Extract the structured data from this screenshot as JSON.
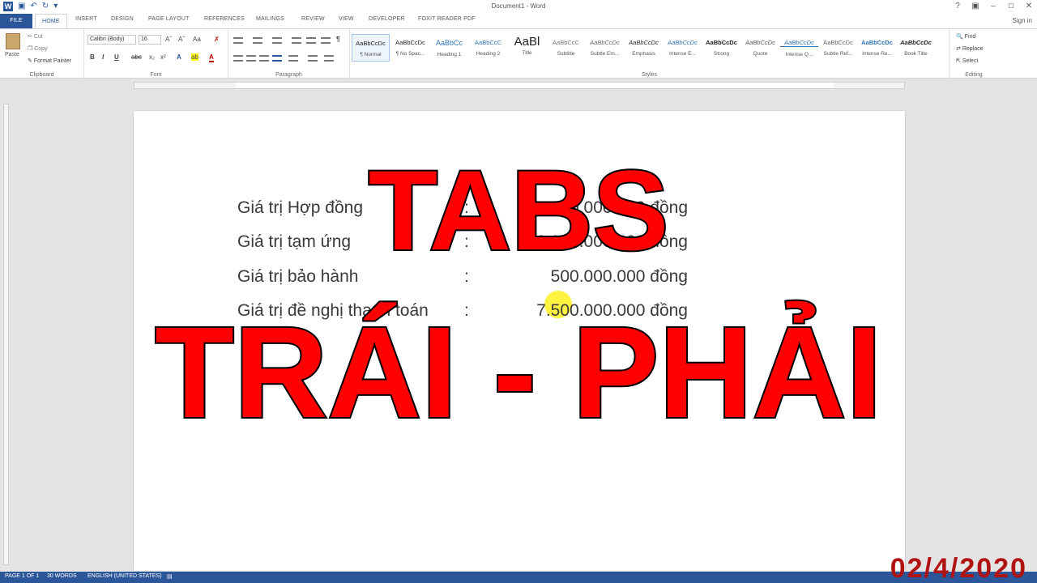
{
  "window": {
    "title": "Document1 - Word",
    "help": "?",
    "sign_in": "Sign in"
  },
  "quick_access": {
    "app_icon": "word-logo-icon",
    "save_icon": "save-icon",
    "undo_icon": "undo-icon",
    "redo_icon": "redo-icon",
    "customize_icon": "chevron-down-icon"
  },
  "tabs": [
    {
      "label": "FILE"
    },
    {
      "label": "HOME"
    },
    {
      "label": "INSERT"
    },
    {
      "label": "DESIGN"
    },
    {
      "label": "PAGE LAYOUT"
    },
    {
      "label": "REFERENCES"
    },
    {
      "label": "MAILINGS"
    },
    {
      "label": "REVIEW"
    },
    {
      "label": "VIEW"
    },
    {
      "label": "DEVELOPER"
    },
    {
      "label": "FOXIT READER PDF"
    }
  ],
  "ribbon": {
    "clipboard": {
      "label": "Clipboard",
      "paste": "Paste",
      "cut": "Cut",
      "copy": "Copy",
      "format_painter": "Format Painter"
    },
    "font": {
      "label": "Font",
      "font_name": "Calibri (Body)",
      "font_size": "16",
      "bold": "B",
      "italic": "I",
      "underline": "U"
    },
    "paragraph": {
      "label": "Paragraph"
    },
    "styles": {
      "label": "Styles",
      "items": [
        {
          "sample": "AaBbCcDc",
          "name": "¶ Normal"
        },
        {
          "sample": "AaBbCcDc",
          "name": "¶ No Spac..."
        },
        {
          "sample": "AaBbCc",
          "name": "Heading 1"
        },
        {
          "sample": "AaBbCcC",
          "name": "Heading 2"
        },
        {
          "sample": "AaBl",
          "name": "Title"
        },
        {
          "sample": "AaBbCcC",
          "name": "Subtitle"
        },
        {
          "sample": "AaBbCcDc",
          "name": "Subtle Em..."
        },
        {
          "sample": "AaBbCcDc",
          "name": "Emphasis"
        },
        {
          "sample": "AaBbCcDc",
          "name": "Intense E..."
        },
        {
          "sample": "AaBbCcDc",
          "name": "Strong"
        },
        {
          "sample": "AaBbCcDc",
          "name": "Quote"
        },
        {
          "sample": "AaBbCcDc",
          "name": "Intense Q..."
        },
        {
          "sample": "AaBbCcDc",
          "name": "Subtle Ref..."
        },
        {
          "sample": "AaBbCcDc",
          "name": "Intense Re..."
        },
        {
          "sample": "AaBbCcDc",
          "name": "Book Title"
        }
      ]
    },
    "editing": {
      "label": "Editing",
      "find": "Find",
      "replace": "Replace",
      "select": "Select"
    }
  },
  "document": {
    "rows": [
      {
        "label": "Giá trị Hợp đồng",
        "colon": ":",
        "value": "10.000.000.000 đồng"
      },
      {
        "label": "Giá trị tạm ứng",
        "colon": ":",
        "value": "2.000.000.000 đồng"
      },
      {
        "label": "Giá trị bảo hành",
        "colon": ":",
        "value": "500.000.000 đồng"
      },
      {
        "label": "Giá trị đề nghị thanh toán",
        "colon": ":",
        "value": "7.500.000.000 đồng"
      }
    ]
  },
  "overlay": {
    "line1": "TABS",
    "line2": "TRÁI - PHẢI"
  },
  "status_bar": {
    "page": "PAGE 1 OF 1",
    "words": "30 WORDS",
    "language": "ENGLISH (UNITED STATES)"
  },
  "date_stamp": "02/4/2020",
  "colors": {
    "accent": "#2b579a",
    "overlay_text": "#ff0000",
    "overlay_outline": "#000000",
    "date_stamp": "#b11212",
    "cursor_highlight": "#ffee00"
  }
}
